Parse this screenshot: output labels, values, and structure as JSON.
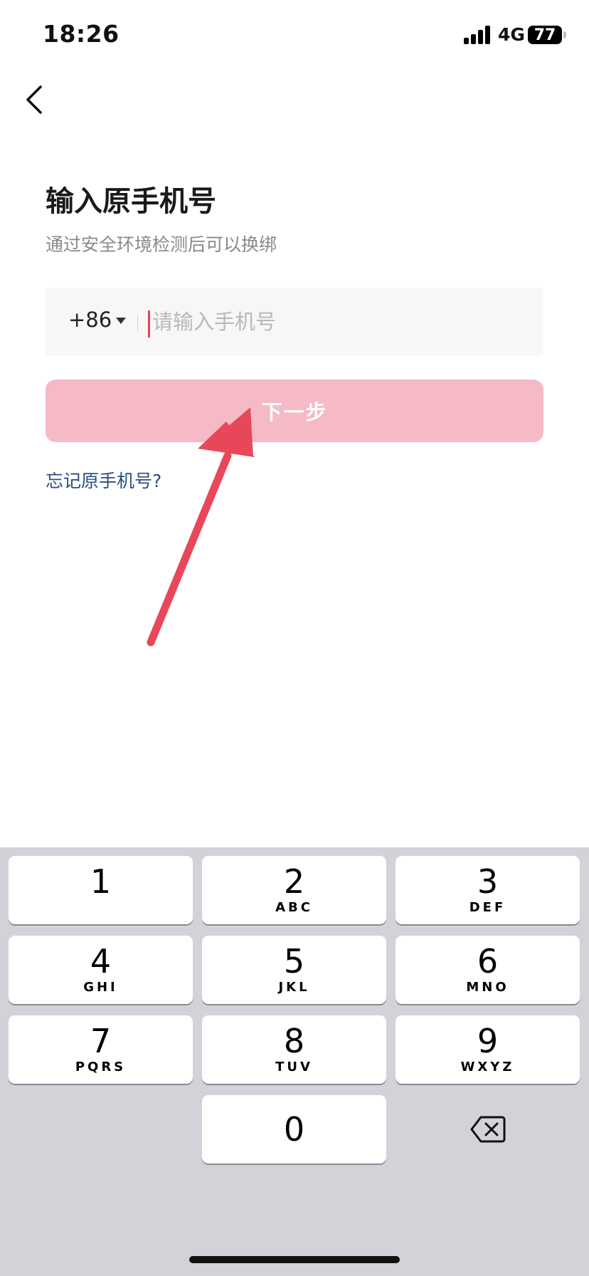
{
  "status_bar": {
    "time": "18:26",
    "network": "4G",
    "battery": "77"
  },
  "page": {
    "title": "输入原手机号",
    "subtitle": "通过安全环境检测后可以换绑"
  },
  "phone": {
    "country_code": "+86",
    "value": "",
    "placeholder": "请输入手机号"
  },
  "next_button": {
    "label": "下一步"
  },
  "forgot_link": {
    "label": "忘记原手机号?"
  },
  "colors": {
    "accent": "#e8425a",
    "button_disabled": "#f5bac6",
    "link": "#2a4f7e",
    "annotation_arrow": "#e8475a"
  },
  "keyboard": {
    "keys": [
      {
        "digit": "1",
        "letters": ""
      },
      {
        "digit": "2",
        "letters": "ABC"
      },
      {
        "digit": "3",
        "letters": "DEF"
      },
      {
        "digit": "4",
        "letters": "GHI"
      },
      {
        "digit": "5",
        "letters": "JKL"
      },
      {
        "digit": "6",
        "letters": "MNO"
      },
      {
        "digit": "7",
        "letters": "PQRS"
      },
      {
        "digit": "8",
        "letters": "TUV"
      },
      {
        "digit": "9",
        "letters": "WXYZ"
      },
      {
        "digit": "0",
        "letters": ""
      }
    ],
    "backspace_icon": "delete-left-icon"
  }
}
